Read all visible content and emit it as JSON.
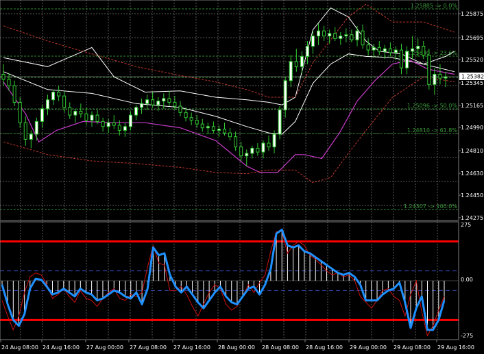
{
  "chart_data": [
    {
      "type": "candlestick",
      "panel": "price",
      "ylim": [
        1.4236,
        1.2596
      ],
      "y_ticks": [
        "1.25875",
        "1.25695",
        "1.25520",
        "1.25345",
        "1.25165",
        "1.24990",
        "1.24810",
        "1.24630",
        "1.24450",
        "1.24275"
      ],
      "current_price_tag": "1.25382",
      "grid": true,
      "colors": {
        "background": "#000000",
        "grid": "#5a5a5a",
        "bull_candle": "#ffffff",
        "bear_candle": "#000000",
        "candle_outline": "#32cd32",
        "bands_outer": "#ffffff",
        "envelope": "#c0392b",
        "lower_line": "#c83cc8",
        "fibo": "#2e8b2e",
        "fibo_text": "#3a9a3a"
      },
      "fibo_levels": [
        {
          "label": "1.25885 -> 0.0%",
          "price": 1.25885
        },
        {
          "label": "1.25600 -> 23.6%",
          "price": 1.256
        },
        {
          "label": "1.25382",
          "price": 1.25382
        },
        {
          "label": "1.25096 -> 50.0%",
          "price": 1.25096
        },
        {
          "label": "1.24810 -> 61.8%",
          "price": 1.2481
        },
        {
          "label": "1.24307 -> 100.0%",
          "price": 1.24307
        }
      ],
      "series": [
        {
          "name": "upper_band",
          "x": [
            0,
            10,
            20,
            25,
            32,
            40,
            48,
            55,
            60,
            63,
            66,
            70,
            74,
            78,
            82,
            85,
            90,
            95,
            100,
            102
          ],
          "y": [
            1.2553,
            1.2546,
            1.2561,
            1.2538,
            1.2526,
            1.2527,
            1.2522,
            1.252,
            1.2518,
            1.2516,
            1.2522,
            1.2575,
            1.2592,
            1.2585,
            1.2566,
            1.2558,
            1.2556,
            1.2548,
            1.2554,
            1.2558
          ]
        },
        {
          "name": "middle_band",
          "x": [
            0,
            10,
            20,
            30,
            40,
            48,
            55,
            60,
            63,
            66,
            70,
            74,
            78,
            82,
            88,
            95,
            102
          ],
          "y": [
            1.2542,
            1.2528,
            1.2525,
            1.2517,
            1.2514,
            1.2507,
            1.2499,
            1.2494,
            1.2493,
            1.2503,
            1.2533,
            1.2548,
            1.2556,
            1.2554,
            1.2553,
            1.2548,
            1.2542
          ]
        },
        {
          "name": "lower_band",
          "x": [
            0,
            5,
            8,
            12,
            18,
            25,
            32,
            40,
            48,
            55,
            58,
            62,
            66,
            68,
            72,
            76,
            80,
            84,
            88,
            92,
            96,
            102
          ],
          "y": [
            1.2534,
            1.2509,
            1.2487,
            1.2496,
            1.2503,
            1.2502,
            1.2502,
            1.2498,
            1.2488,
            1.2468,
            1.2463,
            1.2463,
            1.2477,
            1.2477,
            1.2474,
            1.2494,
            1.2519,
            1.2535,
            1.2548,
            1.2551,
            1.2544,
            1.254
          ]
        },
        {
          "name": "envelope_upper",
          "x": [
            0,
            10,
            20,
            30,
            40,
            48,
            55,
            60,
            66,
            70,
            78,
            82,
            88,
            95,
            102
          ],
          "y": [
            1.2578,
            1.2566,
            1.2556,
            1.2546,
            1.2539,
            1.2534,
            1.2528,
            1.2522,
            1.2522,
            1.2549,
            1.2585,
            1.2595,
            1.2581,
            1.2581,
            1.2573
          ]
        },
        {
          "name": "envelope_lower",
          "x": [
            0,
            10,
            20,
            30,
            40,
            48,
            55,
            60,
            66,
            70,
            74,
            78,
            82,
            88,
            95,
            102
          ],
          "y": [
            1.2487,
            1.2477,
            1.2472,
            1.247,
            1.2467,
            1.2463,
            1.2462,
            1.2465,
            1.2465,
            1.2455,
            1.2459,
            1.2478,
            1.2496,
            1.2522,
            1.2538,
            1.2534
          ]
        }
      ],
      "candles": [
        {
          "o": 1.254,
          "h": 1.2548,
          "l": 1.2531,
          "c": 1.2536
        },
        {
          "o": 1.2536,
          "h": 1.2541,
          "l": 1.2527,
          "c": 1.2531
        },
        {
          "o": 1.2531,
          "h": 1.2535,
          "l": 1.2515,
          "c": 1.2518
        },
        {
          "o": 1.2518,
          "h": 1.2522,
          "l": 1.2498,
          "c": 1.2502
        },
        {
          "o": 1.2502,
          "h": 1.2507,
          "l": 1.2484,
          "c": 1.2489
        },
        {
          "o": 1.2489,
          "h": 1.2496,
          "l": 1.2482,
          "c": 1.2493
        },
        {
          "o": 1.2493,
          "h": 1.2506,
          "l": 1.2488,
          "c": 1.2503
        },
        {
          "o": 1.2503,
          "h": 1.2516,
          "l": 1.2498,
          "c": 1.2513
        },
        {
          "o": 1.2513,
          "h": 1.2524,
          "l": 1.2508,
          "c": 1.252
        },
        {
          "o": 1.252,
          "h": 1.2528,
          "l": 1.2516,
          "c": 1.2526
        },
        {
          "o": 1.2526,
          "h": 1.2531,
          "l": 1.2519,
          "c": 1.2523
        },
        {
          "o": 1.2523,
          "h": 1.2527,
          "l": 1.251,
          "c": 1.2514
        },
        {
          "o": 1.2514,
          "h": 1.2518,
          "l": 1.2505,
          "c": 1.2508
        },
        {
          "o": 1.2508,
          "h": 1.2513,
          "l": 1.2502,
          "c": 1.2511
        },
        {
          "o": 1.2511,
          "h": 1.2517,
          "l": 1.2506,
          "c": 1.2509
        },
        {
          "o": 1.2509,
          "h": 1.2514,
          "l": 1.25,
          "c": 1.2504
        },
        {
          "o": 1.2504,
          "h": 1.2511,
          "l": 1.2499,
          "c": 1.2508
        },
        {
          "o": 1.2508,
          "h": 1.2512,
          "l": 1.2501,
          "c": 1.2503
        },
        {
          "o": 1.2503,
          "h": 1.2506,
          "l": 1.2495,
          "c": 1.2499
        },
        {
          "o": 1.2499,
          "h": 1.2505,
          "l": 1.2494,
          "c": 1.2502
        },
        {
          "o": 1.2502,
          "h": 1.2508,
          "l": 1.2497,
          "c": 1.25
        },
        {
          "o": 1.25,
          "h": 1.2504,
          "l": 1.2492,
          "c": 1.2496
        },
        {
          "o": 1.2496,
          "h": 1.2502,
          "l": 1.2491,
          "c": 1.2499
        },
        {
          "o": 1.2499,
          "h": 1.2511,
          "l": 1.2496,
          "c": 1.2508
        },
        {
          "o": 1.2508,
          "h": 1.2516,
          "l": 1.2504,
          "c": 1.2514
        },
        {
          "o": 1.2514,
          "h": 1.2521,
          "l": 1.2509,
          "c": 1.2517
        },
        {
          "o": 1.2517,
          "h": 1.2524,
          "l": 1.2512,
          "c": 1.252
        },
        {
          "o": 1.252,
          "h": 1.2526,
          "l": 1.2514,
          "c": 1.2516
        },
        {
          "o": 1.2516,
          "h": 1.2522,
          "l": 1.2511,
          "c": 1.2519
        },
        {
          "o": 1.2519,
          "h": 1.2525,
          "l": 1.2513,
          "c": 1.2521
        },
        {
          "o": 1.2521,
          "h": 1.2527,
          "l": 1.2515,
          "c": 1.2518
        },
        {
          "o": 1.2518,
          "h": 1.2523,
          "l": 1.2512,
          "c": 1.2515
        },
        {
          "o": 1.2515,
          "h": 1.2519,
          "l": 1.2507,
          "c": 1.251
        },
        {
          "o": 1.251,
          "h": 1.2514,
          "l": 1.2503,
          "c": 1.2506
        },
        {
          "o": 1.2506,
          "h": 1.251,
          "l": 1.25,
          "c": 1.2504
        },
        {
          "o": 1.2504,
          "h": 1.2508,
          "l": 1.2498,
          "c": 1.2501
        },
        {
          "o": 1.2501,
          "h": 1.2505,
          "l": 1.2495,
          "c": 1.2498
        },
        {
          "o": 1.2498,
          "h": 1.2502,
          "l": 1.2493,
          "c": 1.2499
        },
        {
          "o": 1.2499,
          "h": 1.2503,
          "l": 1.2494,
          "c": 1.2496
        },
        {
          "o": 1.2496,
          "h": 1.25,
          "l": 1.2491,
          "c": 1.2497
        },
        {
          "o": 1.2497,
          "h": 1.2502,
          "l": 1.2492,
          "c": 1.2494
        },
        {
          "o": 1.2494,
          "h": 1.2498,
          "l": 1.2488,
          "c": 1.2491
        },
        {
          "o": 1.2491,
          "h": 1.2495,
          "l": 1.248,
          "c": 1.2483
        },
        {
          "o": 1.2483,
          "h": 1.2487,
          "l": 1.2472,
          "c": 1.2476
        },
        {
          "o": 1.2476,
          "h": 1.2481,
          "l": 1.2468,
          "c": 1.2478
        },
        {
          "o": 1.2478,
          "h": 1.2484,
          "l": 1.2474,
          "c": 1.2482
        },
        {
          "o": 1.2482,
          "h": 1.2486,
          "l": 1.2476,
          "c": 1.2479
        },
        {
          "o": 1.2479,
          "h": 1.2488,
          "l": 1.2474,
          "c": 1.2486
        },
        {
          "o": 1.2486,
          "h": 1.2492,
          "l": 1.248,
          "c": 1.2483
        },
        {
          "o": 1.2483,
          "h": 1.2496,
          "l": 1.2478,
          "c": 1.2493
        },
        {
          "o": 1.2493,
          "h": 1.2515,
          "l": 1.2489,
          "c": 1.2512
        },
        {
          "o": 1.2512,
          "h": 1.2538,
          "l": 1.2506,
          "c": 1.2535
        },
        {
          "o": 1.2535,
          "h": 1.2555,
          "l": 1.253,
          "c": 1.255
        },
        {
          "o": 1.255,
          "h": 1.256,
          "l": 1.2542,
          "c": 1.2546
        },
        {
          "o": 1.2546,
          "h": 1.2558,
          "l": 1.254,
          "c": 1.2554
        },
        {
          "o": 1.2554,
          "h": 1.2566,
          "l": 1.2548,
          "c": 1.2562
        },
        {
          "o": 1.2562,
          "h": 1.2574,
          "l": 1.2556,
          "c": 1.257
        },
        {
          "o": 1.257,
          "h": 1.258,
          "l": 1.2563,
          "c": 1.2574
        },
        {
          "o": 1.2574,
          "h": 1.2578,
          "l": 1.2566,
          "c": 1.257
        },
        {
          "o": 1.257,
          "h": 1.2575,
          "l": 1.2564,
          "c": 1.2572
        },
        {
          "o": 1.2572,
          "h": 1.2577,
          "l": 1.2566,
          "c": 1.2568
        },
        {
          "o": 1.2568,
          "h": 1.2573,
          "l": 1.2563,
          "c": 1.257
        },
        {
          "o": 1.257,
          "h": 1.2576,
          "l": 1.2565,
          "c": 1.2571
        },
        {
          "o": 1.2571,
          "h": 1.2575,
          "l": 1.2565,
          "c": 1.2567
        },
        {
          "o": 1.2567,
          "h": 1.2578,
          "l": 1.2562,
          "c": 1.2574
        },
        {
          "o": 1.2574,
          "h": 1.2579,
          "l": 1.256,
          "c": 1.2563
        },
        {
          "o": 1.2563,
          "h": 1.2568,
          "l": 1.2555,
          "c": 1.2559
        },
        {
          "o": 1.2559,
          "h": 1.2564,
          "l": 1.2553,
          "c": 1.2561
        },
        {
          "o": 1.2561,
          "h": 1.2566,
          "l": 1.2555,
          "c": 1.2558
        },
        {
          "o": 1.2558,
          "h": 1.2563,
          "l": 1.2552,
          "c": 1.256
        },
        {
          "o": 1.256,
          "h": 1.2565,
          "l": 1.2554,
          "c": 1.2557
        },
        {
          "o": 1.2557,
          "h": 1.2562,
          "l": 1.2551,
          "c": 1.2559
        },
        {
          "o": 1.2559,
          "h": 1.2564,
          "l": 1.254,
          "c": 1.2545
        },
        {
          "o": 1.2545,
          "h": 1.2562,
          "l": 1.254,
          "c": 1.2558
        },
        {
          "o": 1.2558,
          "h": 1.257,
          "l": 1.2552,
          "c": 1.256
        },
        {
          "o": 1.256,
          "h": 1.2568,
          "l": 1.2554,
          "c": 1.2562
        },
        {
          "o": 1.2562,
          "h": 1.2566,
          "l": 1.2552,
          "c": 1.2555
        },
        {
          "o": 1.2555,
          "h": 1.256,
          "l": 1.2528,
          "c": 1.2532
        },
        {
          "o": 1.2532,
          "h": 1.2545,
          "l": 1.2524,
          "c": 1.254
        },
        {
          "o": 1.254,
          "h": 1.2548,
          "l": 1.2532,
          "c": 1.2537
        },
        {
          "o": 1.2537,
          "h": 1.2542,
          "l": 1.253,
          "c": 1.2538
        }
      ]
    },
    {
      "type": "line",
      "panel": "oscillator",
      "ylim": [
        -300,
        300
      ],
      "y_ticks": [
        "275",
        "0.00",
        "-275"
      ],
      "levels": {
        "upper": 200,
        "lower": -200,
        "dashed": [
          50,
          -50
        ]
      },
      "colors": {
        "level_line": "#ff0000",
        "dashed": "#3c50c8",
        "histogram": "#ffffff",
        "main_line": "#1e90ff",
        "signal_line": "#d01010"
      },
      "x_labels": [
        "24 Aug 08:00",
        "24 Aug 16:00",
        "27 Aug 00:00",
        "27 Aug 08:00",
        "27 Aug 16:00",
        "28 Aug 00:00",
        "28 Aug 08:00",
        "28 Aug 16:00",
        "29 Aug 00:00",
        "29 Aug 08:00",
        "29 Aug 16:00"
      ],
      "series": [
        {
          "name": "main",
          "values": [
            -20,
            -120,
            -200,
            -230,
            -170,
            -40,
            10,
            5,
            -30,
            -70,
            -60,
            -40,
            -60,
            -80,
            -40,
            -60,
            -70,
            -100,
            -90,
            -70,
            -50,
            -60,
            -80,
            -90,
            -60,
            -120,
            -40,
            170,
            130,
            140,
            30,
            -30,
            -60,
            -30,
            -70,
            -110,
            -140,
            -100,
            -60,
            -30,
            -80,
            -110,
            -120,
            -80,
            -40,
            -30,
            -70,
            -20,
            60,
            240,
            260,
            180,
            170,
            180,
            150,
            140,
            120,
            100,
            80,
            60,
            40,
            30,
            40,
            20,
            -20,
            -100,
            -100,
            -100,
            -70,
            -50,
            -40,
            -10,
            -110,
            -240,
            -140,
            -80,
            -250,
            -250,
            -200,
            -100
          ]
        },
        {
          "name": "signal",
          "values": [
            -100,
            -180,
            -250,
            -180,
            -60,
            20,
            40,
            30,
            -20,
            -90,
            -70,
            -40,
            -80,
            -110,
            -50,
            -90,
            -100,
            -130,
            -90,
            -60,
            -40,
            -90,
            -100,
            -70,
            -80,
            -60,
            70,
            180,
            90,
            80,
            -50,
            -50,
            -30,
            -70,
            -130,
            -180,
            -120,
            -60,
            -20,
            -40,
            -120,
            -150,
            -130,
            -80,
            -20,
            -60,
            -10,
            30,
            150,
            250,
            250,
            140,
            180,
            200,
            180,
            130,
            110,
            80,
            50,
            30,
            40,
            20,
            30,
            0,
            -80,
            -110,
            -140,
            -100,
            -50,
            -40,
            -80,
            -100,
            -180,
            -70,
            0,
            -160,
            -280,
            -230,
            -150,
            -80
          ]
        }
      ]
    }
  ]
}
